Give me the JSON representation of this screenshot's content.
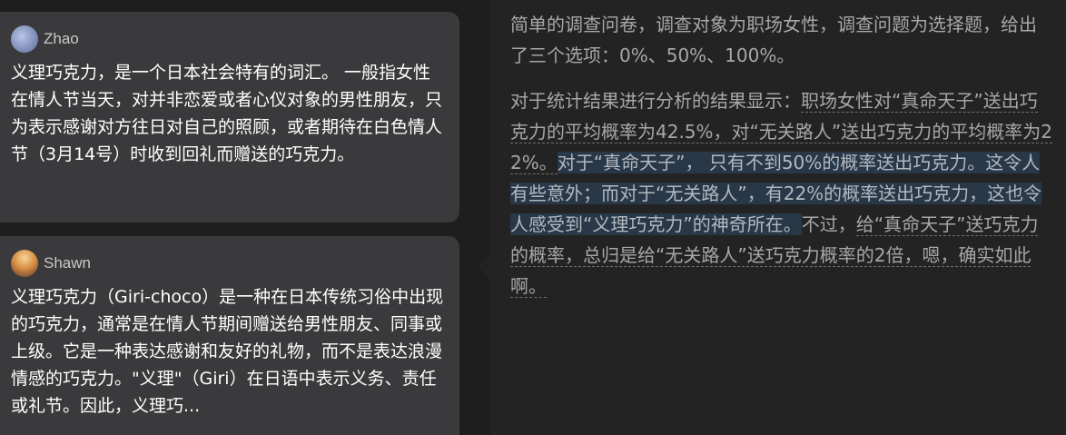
{
  "comments": [
    {
      "username": "Zhao",
      "avatar_icon": "user-avatar-icon",
      "text": "义理巧克力，是一个日本社会特有的词汇。 一般指女性在情人节当天，对并非恋爱或者心仪对象的男性朋友，只为表示感谢对方往日对自己的照顾，或者期待在白色情人节（3月14号）时收到回礼而赠送的巧克力。"
    },
    {
      "username": "Shawn",
      "avatar_icon": "user-avatar-icon",
      "text": "义理巧克力（Giri-choco）是一种在日本传统习俗中出现的巧克力，通常是在情人节期间赠送给男性朋友、同事或上级。它是一种表达感谢和友好的礼物，而不是表达浪漫情感的巧克力。\"义理\"（Giri）在日语中表示义务、责任或礼节。因此，义理巧..."
    }
  ],
  "article": {
    "para1": "简单的调查问卷，调查对象为职场女性，调查问题为选择题，给出了三个选项：0%、50%、100%。",
    "para2_plain": "对于统计结果进行分析的结果显示：",
    "para2_commented": "职场女性对“真命天子”送出巧克力的平均概率为42.5%，对“无关路人”送出巧克力的平均概率为22%。",
    "para2_highlighted": "对于“真命天子”， 只有不到50%的概率送出巧克力。这令人有些意外；而对于“无关路人”，有22%的概率送出巧克力，这也令人感受到“义理巧克力”的神奇所在。",
    "para2_tail_plain": "不过，",
    "para2_tail_commented": "给“真命天子”送巧克力的概率，总归是给“无关路人”送巧克力概率的2倍，嗯，确实如此啊。"
  },
  "colors": {
    "card_bg": "#3a3a3c",
    "article_bg": "#232323",
    "highlight_bg": "#283848",
    "article_text": "#a7a7a7"
  }
}
